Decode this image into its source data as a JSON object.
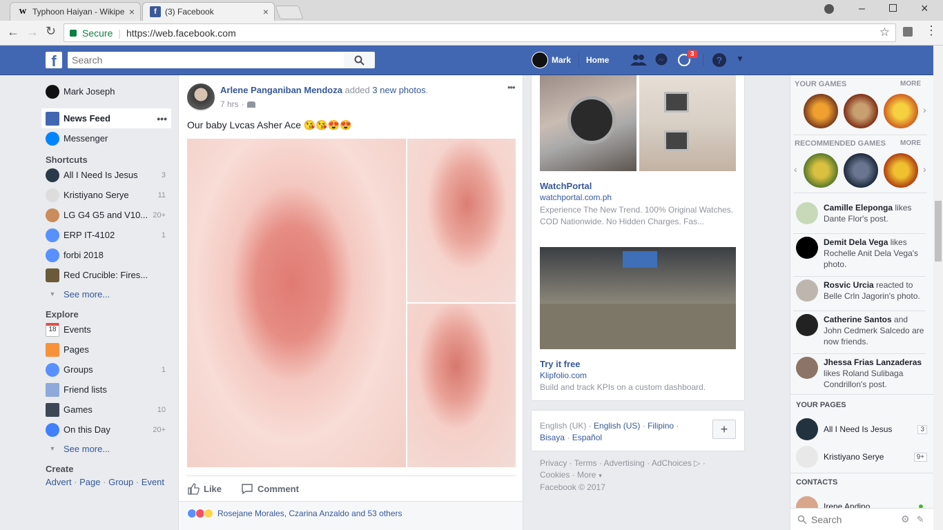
{
  "browser": {
    "tabs": [
      {
        "title": "Typhoon Haiyan - Wikipe",
        "favicon": "W"
      },
      {
        "title": "(3) Facebook",
        "favicon": "f"
      }
    ],
    "secure_label": "Secure",
    "url": "https://web.facebook.com"
  },
  "topbar": {
    "search_placeholder": "Search",
    "profile_name": "Mark",
    "home_label": "Home",
    "notifications_count": "3"
  },
  "leftnav": {
    "profile": "Mark Joseph",
    "news_feed": "News Feed",
    "messenger": "Messenger",
    "shortcuts_title": "Shortcuts",
    "shortcuts": [
      {
        "label": "All I Need Is Jesus",
        "count": "3"
      },
      {
        "label": "Kristiyano Serye",
        "count": "11"
      },
      {
        "label": "LG G4 G5 and V10...",
        "count": "20+"
      },
      {
        "label": "ERP IT-4102",
        "count": "1"
      },
      {
        "label": "forbi 2018",
        "count": ""
      },
      {
        "label": "Red Crucible: Fires...",
        "count": ""
      }
    ],
    "see_more": "See more...",
    "explore_title": "Explore",
    "explore": [
      {
        "label": "Events",
        "count": ""
      },
      {
        "label": "Pages",
        "count": ""
      },
      {
        "label": "Groups",
        "count": "1"
      },
      {
        "label": "Friend lists",
        "count": ""
      },
      {
        "label": "Games",
        "count": "10"
      },
      {
        "label": "On this Day",
        "count": "20+"
      }
    ],
    "events_date": "18",
    "create_title": "Create",
    "create_links": [
      "Advert",
      "Page",
      "Group",
      "Event"
    ]
  },
  "post": {
    "author": "Arlene Panganiban Mendoza",
    "action": "added",
    "action_link": "3 new photos",
    "time": "7 hrs",
    "text": "Our baby Lvcas Asher Ace 😘😘😍😍",
    "like_label": "Like",
    "comment_label": "Comment",
    "reactions_text": "Rosejane Morales, Czarina Anzaldo and 53 others"
  },
  "ads": [
    {
      "title": "WatchPortal",
      "domain": "watchportal.com.ph",
      "body": "Experience The New Trend. 100% Original Watches. COD Nationwide. No Hidden Charges. Fas..."
    },
    {
      "title": "Try it free",
      "domain": "Klipfolio.com",
      "body": "Build and track KPIs on a custom dashboard."
    }
  ],
  "languages": {
    "current": "English (UK)",
    "options": [
      "English (US)",
      "Filipino",
      "Bisaya",
      "Español"
    ],
    "add": "+"
  },
  "footer": {
    "links": [
      "Privacy",
      "Terms",
      "Advertising",
      "AdChoices",
      "Cookies",
      "More"
    ],
    "copyright": "Facebook © 2017"
  },
  "rightbar": {
    "your_games": "YOUR GAMES",
    "more": "MORE",
    "recommended_games": "RECOMMENDED GAMES",
    "ticker": [
      {
        "name": "Camille Eleponga",
        "text": " likes Dante Flor's post."
      },
      {
        "name": "Demit Dela Vega",
        "text": " likes Rochelle Anit Dela Vega's photo."
      },
      {
        "name": "Rosvic Urcia",
        "text": " reacted to Belle Crln Jagorin's photo."
      },
      {
        "name": "Catherine Santos",
        "text": " and John Cedmerk Salcedo are now friends."
      },
      {
        "name": "Jhessa Frias Lanzaderas",
        "text": " likes Roland Sulibaga Condrillon's post."
      }
    ],
    "your_pages": "YOUR PAGES",
    "pages": [
      {
        "name": "All I Need Is Jesus",
        "count": "3"
      },
      {
        "name": "Kristiyano Serye",
        "count": "9+"
      }
    ],
    "contacts": "CONTACTS",
    "contact_partial": "Irene Andino",
    "search_placeholder": "Search"
  }
}
